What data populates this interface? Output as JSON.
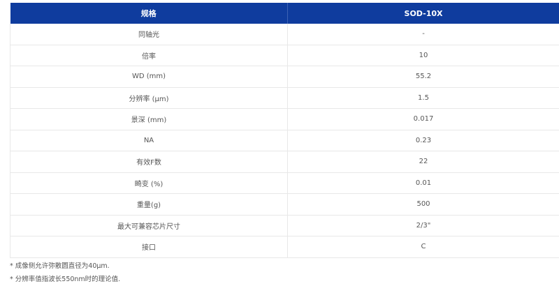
{
  "table": {
    "headers": [
      "规格",
      "SOD-10X"
    ],
    "rows": [
      {
        "label": "同轴光",
        "value": "-"
      },
      {
        "label": "倍率",
        "value": "10"
      },
      {
        "label": "WD (mm)",
        "value": "55.2"
      },
      {
        "label": "分辨率 (μm)",
        "value": "1.5"
      },
      {
        "label": "景深 (mm)",
        "value": "0.017"
      },
      {
        "label": "NA",
        "value": "0.23"
      },
      {
        "label": "有效F数",
        "value": "22"
      },
      {
        "label": "畸变 (%)",
        "value": "0.01"
      },
      {
        "label": "重量(g)",
        "value": "500"
      },
      {
        "label": "最大可兼容芯片尺寸",
        "value": "2/3\""
      },
      {
        "label": "接口",
        "value": "C"
      }
    ]
  },
  "notes": [
    "* 成像侧允许弥散圆直径为40μm.",
    "* 分辨率值指波长550nm时的理论值."
  ],
  "colors": {
    "header_bg": "#0f3c9e",
    "header_text": "#ffffff",
    "border": "#e8e8e8",
    "text": "#555555"
  }
}
